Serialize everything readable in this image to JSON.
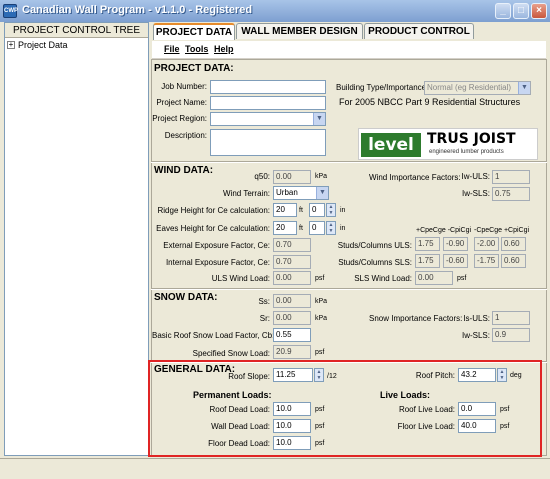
{
  "window": {
    "title": "Canadian Wall Program - v1.1.0 - Registered",
    "app_icon_text": "CWP"
  },
  "left_pane": {
    "header": "PROJECT CONTROL TREE",
    "tree": [
      {
        "label": "Project Data",
        "expander": "+"
      }
    ]
  },
  "tabs": [
    {
      "label": "PROJECT DATA",
      "active": true
    },
    {
      "label": "WALL MEMBER DESIGN",
      "active": false
    },
    {
      "label": "PRODUCT CONTROL",
      "active": false
    }
  ],
  "menu": [
    "File",
    "Tools",
    "Help"
  ],
  "project_data": {
    "heading": "PROJECT DATA:",
    "job_number_label": "Job Number:",
    "job_number": "",
    "project_name_label": "Project Name:",
    "project_name": "",
    "project_region_label": "Project Region:",
    "project_region": "",
    "description_label": "Description:",
    "description": "",
    "building_type_label": "Building Type/Importance:",
    "building_type": "Normal (eg Residential)",
    "nbcc_note": "For 2005 NBCC Part 9 Residential Structures"
  },
  "logo": {
    "level": "level",
    "trus_joist": "TRUS JOIST",
    "sub": "engineered lumber products"
  },
  "wind_data": {
    "heading": "WIND DATA:",
    "q50_label": "q50:",
    "q50": "0.00",
    "q50_unit": "kPa",
    "terrain_label": "Wind Terrain:",
    "terrain": "Urban",
    "ridge_label": "Ridge Height for Ce calculation:",
    "ridge_ft": "20",
    "ridge_in": "0",
    "eaves_label": "Eaves Height for Ce calculation:",
    "eaves_ft": "20",
    "eaves_in": "0",
    "ft_unit": "ft",
    "in_unit": "in",
    "ext_ce_label": "External Exposure Factor, Ce:",
    "ext_ce": "0.70",
    "int_ce_label": "Internal Exposure Factor, Ce:",
    "int_ce": "0.70",
    "uls_wind_label": "ULS Wind Load:",
    "uls_wind": "0.00",
    "psf": "psf",
    "importance_label": "Wind Importance Factors:",
    "iw_uls_label": "Iw-ULS:",
    "iw_uls": "1",
    "iw_sls_label": "Iw-SLS:",
    "iw_sls": "0.75",
    "coef_headers": [
      "+CpeCge -CpiCgi",
      "-CpeCge +CpiCgi"
    ],
    "studs_uls_label": "Studs/Columns ULS:",
    "studs_uls": [
      "1.75",
      "-0.90",
      "-2.00",
      "0.60"
    ],
    "studs_sls_label": "Studs/Columns SLS:",
    "studs_sls": [
      "1.75",
      "-0.60",
      "-1.75",
      "0.60"
    ],
    "sls_wind_label": "SLS Wind Load:",
    "sls_wind": "0.00"
  },
  "snow_data": {
    "heading": "SNOW DATA:",
    "ss_label": "Ss:",
    "ss": "0.00",
    "kpa": "kPa",
    "sr_label": "Sr:",
    "sr": "0.00",
    "cb_label": "Basic Roof Snow Load Factor, Cb:",
    "cb": "0.55",
    "specified_label": "Specified Snow Load:",
    "specified": "20.9",
    "psf": "psf",
    "importance_label": "Snow Importance Factors:",
    "is_uls_label": "Is-ULS:",
    "is_uls": "1",
    "is_sls_label": "Iw-SLS:",
    "is_sls": "0.9"
  },
  "general_data": {
    "heading": "GENERAL DATA:",
    "roof_slope_label": "Roof Slope:",
    "roof_slope": "11.25",
    "slope_unit": "/12",
    "roof_pitch_label": "Roof Pitch:",
    "roof_pitch": "43.2",
    "deg_unit": "deg",
    "perm_heading": "Permanent Loads:",
    "live_heading": "Live Loads:",
    "roof_dead_label": "Roof Dead Load:",
    "roof_dead": "10.0",
    "wall_dead_label": "Wall Dead Load:",
    "wall_dead": "10.0",
    "floor_dead_label": "Floor Dead Load:",
    "floor_dead": "10.0",
    "roof_live_label": "Roof Live Load:",
    "roof_live": "0.0",
    "floor_live_label": "Floor Live Load:",
    "floor_live": "40.0",
    "psf": "psf"
  },
  "colors": {
    "highlight": "#e02424",
    "tab_active_accent": "#e68b2c",
    "logo_green": "#2d7b2d"
  }
}
